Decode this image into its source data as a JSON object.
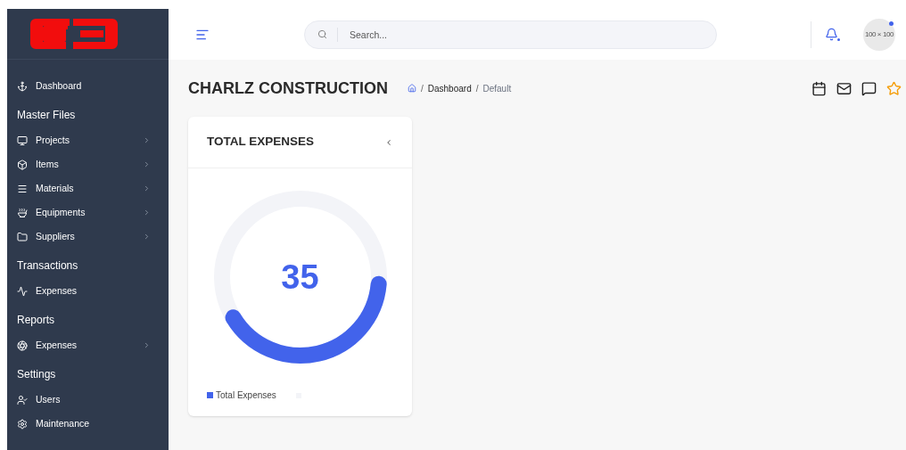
{
  "sidebar": {
    "items": [
      {
        "kind": "link",
        "label": "Dashboard",
        "has_submenu": false
      },
      {
        "kind": "section",
        "label": "Master Files"
      },
      {
        "kind": "link",
        "label": "Projects",
        "has_submenu": true
      },
      {
        "kind": "link",
        "label": "Items",
        "has_submenu": true
      },
      {
        "kind": "link",
        "label": "Materials",
        "has_submenu": true
      },
      {
        "kind": "link",
        "label": "Equipments",
        "has_submenu": true
      },
      {
        "kind": "link",
        "label": "Suppliers",
        "has_submenu": true
      },
      {
        "kind": "section",
        "label": "Transactions"
      },
      {
        "kind": "link",
        "label": "Expenses",
        "has_submenu": false
      },
      {
        "kind": "section",
        "label": "Reports"
      },
      {
        "kind": "link",
        "label": "Expenses",
        "has_submenu": true
      },
      {
        "kind": "section",
        "label": "Settings"
      },
      {
        "kind": "link",
        "label": "Users",
        "has_submenu": false
      },
      {
        "kind": "link",
        "label": "Maintenance",
        "has_submenu": false
      }
    ]
  },
  "header": {
    "search": {
      "placeholder": "Search..."
    },
    "avatar": {
      "text": "100 × 100",
      "online": true
    },
    "notification": true
  },
  "page": {
    "title": "CHARLZ CONSTRUCTION",
    "breadcrumb": [
      {
        "separator": "/",
        "label": "Dashboard"
      },
      {
        "separator": "/",
        "label": "Default"
      }
    ]
  },
  "card": {
    "title": "TOTAL EXPENSES",
    "gauge": {
      "value": "35",
      "color": "#4263eb"
    },
    "legend": "Total Expenses"
  }
}
